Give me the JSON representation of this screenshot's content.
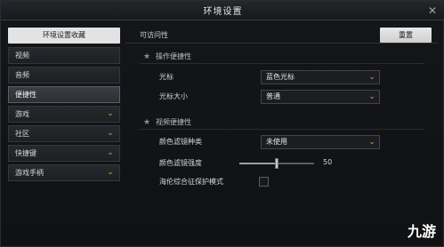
{
  "window": {
    "title": "环境设置",
    "close_glyph": "✕"
  },
  "sidebar": {
    "header": "环境设置收藏",
    "items": [
      {
        "label": "视频",
        "has_chevron": false,
        "active": false
      },
      {
        "label": "音频",
        "has_chevron": false,
        "active": false
      },
      {
        "label": "便捷性",
        "has_chevron": false,
        "active": true
      },
      {
        "label": "游戏",
        "has_chevron": true,
        "active": false
      },
      {
        "label": "社区",
        "has_chevron": true,
        "active": false
      },
      {
        "label": "快捷键",
        "has_chevron": true,
        "active": false
      },
      {
        "label": "游戏手柄",
        "has_chevron": true,
        "active": false
      }
    ],
    "chevron_glyph": "⌄"
  },
  "main": {
    "section_title": "可访问性",
    "reset_label": "重置",
    "groups": [
      {
        "title": "操作便捷性",
        "rows": [
          {
            "label": "光标",
            "type": "select",
            "value": "蓝色光标"
          },
          {
            "label": "光标大小",
            "type": "select",
            "value": "普通"
          }
        ]
      },
      {
        "title": "视频便捷性",
        "rows": [
          {
            "label": "颜色滤镜种类",
            "type": "select",
            "value": "未使用"
          },
          {
            "label": "颜色滤镜强度",
            "type": "slider",
            "value": "50",
            "fraction": 0.5
          },
          {
            "label": "海伦综合征保护模式",
            "type": "checkbox",
            "checked": false
          }
        ]
      }
    ]
  },
  "watermark": "九游",
  "colors": {
    "accent": "#d4a63c",
    "button_bg": "#e3e3e3"
  }
}
